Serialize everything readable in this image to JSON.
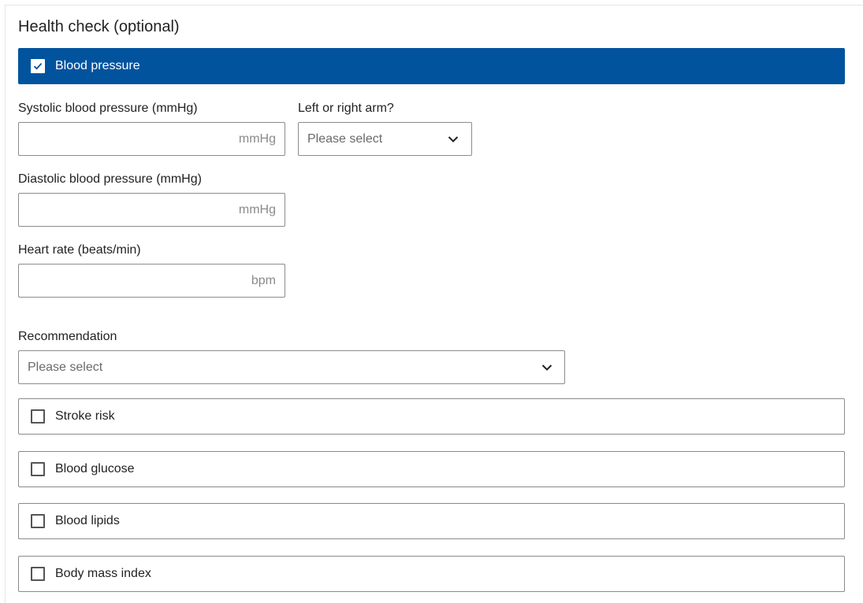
{
  "section": {
    "title": "Health check (optional)"
  },
  "blood_pressure": {
    "label": "Blood pressure",
    "checked": true,
    "systolic": {
      "label": "Systolic blood pressure (mmHg)",
      "unit": "mmHg",
      "value": ""
    },
    "arm": {
      "label": "Left or right arm?",
      "selected": "Please select"
    },
    "diastolic": {
      "label": "Diastolic blood pressure (mmHg)",
      "unit": "mmHg",
      "value": ""
    },
    "heart_rate": {
      "label": "Heart rate (beats/min)",
      "unit": "bpm",
      "value": ""
    },
    "recommendation": {
      "label": "Recommendation",
      "selected": "Please select"
    }
  },
  "checks": [
    {
      "label": "Stroke risk",
      "checked": false
    },
    {
      "label": "Blood glucose",
      "checked": false
    },
    {
      "label": "Blood lipids",
      "checked": false
    },
    {
      "label": "Body mass index",
      "checked": false
    }
  ],
  "colors": {
    "accent": "#02539e",
    "border": "#8c8c8c",
    "muted": "#8a8a8a"
  }
}
